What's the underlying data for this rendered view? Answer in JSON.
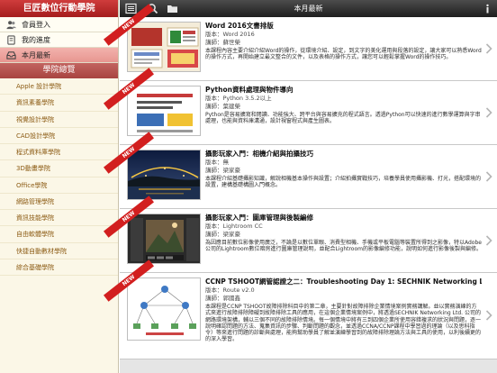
{
  "sidebar": {
    "app_title": "巨匠數位行動學院",
    "nav": [
      {
        "label": "會員登入",
        "icon": "users-icon"
      },
      {
        "label": "我的進度",
        "icon": "book-icon"
      },
      {
        "label": "本月最新",
        "icon": "inbox-icon"
      }
    ],
    "section_title": "學院總覽",
    "categories": [
      "Apple 設計學院",
      "資訊素養學院",
      "視覺設計學院",
      "CAD設計學院",
      "程式資料庫學院",
      "3D動畫學院",
      "Office學院",
      "網路管理學院",
      "資訊技能學院",
      "自由軟體學院",
      "快捷自動數材學院",
      "綜合基礎學院"
    ]
  },
  "topbar": {
    "title": "本月最新",
    "icons": [
      "list-icon",
      "search-icon",
      "folder-icon",
      "info-icon"
    ]
  },
  "courses": [
    {
      "ribbon": "NEW",
      "title": "Word 2016文書排版",
      "version": "版本：Word 2016",
      "lecturer": "講師：蘇世榮",
      "desc": "本課程內容主要介紹介紹Word的操作，從環境介紹、設定，到文字的美化運用與段落的設定，讓大家可以熟悉Word的操作方式，再開始建立最文整合的文件，以及表格的操作方式，讓您可以輕鬆掌握Word的操作技巧。"
    },
    {
      "ribbon": "NEW",
      "title": "Python資料處理與物件導向",
      "version": "版本：Python 3.5.2以上",
      "lecturer": "講師：葉建榮",
      "desc": "Python是容易擴寫和閱讀、功能強大、跨平台與容易擴充的程式語言。透過Python可以快速的進行數學運算與字串處理，也能與資料庫溝通，設計視窗程式與產生圖表。"
    },
    {
      "ribbon": "NEW",
      "title": "攝影玩家入門：相機介紹與拍攝技巧",
      "version": "版本：無",
      "lecturer": "講師：梁家豪",
      "desc": "本課程介紹基礎攝影知識，解說相機基本操作與設置；介紹拍攝實戰技巧，培養學員使用攝影機、打光，搭配環境的設置，建構基礎構圖入門概念。"
    },
    {
      "ribbon": "NEW",
      "title": "攝影玩家入門：圖庫管理與後製編修",
      "version": "版本：Lightroom CC",
      "lecturer": "講師：梁家豪",
      "desc": "為因應目前數位影像使用廣泛，不論是以數位單眼、消費型相機、手機或平板電腦等裝置所得到之影像，特以Adobe公司的Lightroom數位暗房進行圖庫管理說明，並配合Lightroom的影像編修功能，說明如何進行影像後製與編修。"
    },
    {
      "ribbon": "NEW",
      "title": "CCNP TSHOOT網管認證之二：Troubleshooting Day 1: SECHNIK Networking Ltd.",
      "version": "版本：Route v2.0",
      "lecturer": "講師：郭國鑫",
      "desc": "本課程是CCNP TSHOOT故障排除科目中的第二章，主要針對故障排除企業情境案例實務講解。並以實務演練的方式來進行故障排除障礙到故障排除工具的應用，在這個企業情境案例中，將透過SECHNIK Networking Ltd. 公司的網路環境架構，輔以三個不同的故障排除情境。每一個情境中將有三到四個企業所使用容錯複求的狀況與問題，逐一說明確認問題的方法、蒐集資訊的步驟、判斷問題的觀念，並透過CCNA/CCNP課程中學習過的理論（以及思科指令）等來進行問題的診斷與處理，能夠幫助學員了解並演練學習到的故障排除理論方法與工具的使用，以利後續更的的深入學習。"
    }
  ],
  "colors": {
    "sidebar_header": "#b82a2a",
    "sidebar_bg": "#fbf7e7",
    "category_text": "#8b5a12",
    "ribbon": "#d21f1f",
    "topbar": "#2d2d2d"
  }
}
